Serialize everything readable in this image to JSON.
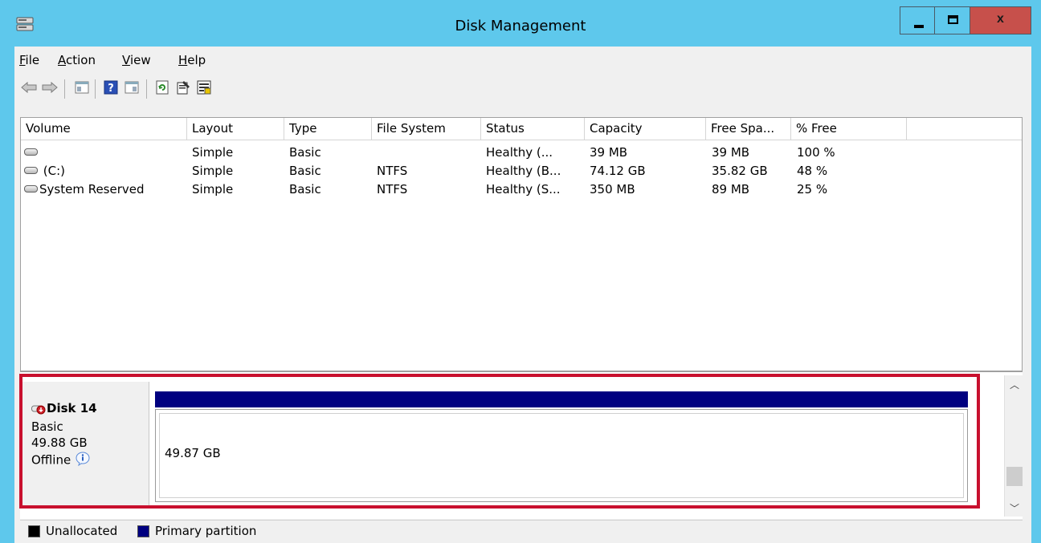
{
  "window": {
    "title": "Disk Management"
  },
  "menubar": {
    "items": [
      {
        "label": "File",
        "underline": "F"
      },
      {
        "label": "Action",
        "underline": "A"
      },
      {
        "label": "View",
        "underline": "V"
      },
      {
        "label": "Help",
        "underline": "H"
      }
    ]
  },
  "toolbar": {
    "buttons": [
      "back-icon",
      "forward-icon",
      "show-hide-console-tree-icon",
      "help-icon",
      "show-action-pane-icon",
      "refresh-icon",
      "properties-icon",
      "export-list-icon"
    ]
  },
  "volume_list": {
    "columns": [
      "Volume",
      "Layout",
      "Type",
      "File System",
      "Status",
      "Capacity",
      "Free Spa...",
      "% Free"
    ],
    "rows": [
      {
        "volume": "",
        "layout": "Simple",
        "type": "Basic",
        "file_system": "",
        "status": "Healthy (...",
        "capacity": "39 MB",
        "free_space": "39 MB",
        "percent_free": "100 %"
      },
      {
        "volume": "(C:)",
        "layout": "Simple",
        "type": "Basic",
        "file_system": "NTFS",
        "status": "Healthy (B...",
        "capacity": "74.12 GB",
        "free_space": "35.82 GB",
        "percent_free": "48 %"
      },
      {
        "volume": "System Reserved",
        "layout": "Simple",
        "type": "Basic",
        "file_system": "NTFS",
        "status": "Healthy (S...",
        "capacity": "350 MB",
        "free_space": "89 MB",
        "percent_free": "25 %"
      }
    ]
  },
  "disk": {
    "name": "Disk 14",
    "type": "Basic",
    "size": "49.88 GB",
    "status": "Offline",
    "partition_size": "49.87 GB"
  },
  "legend": {
    "items": [
      {
        "label": "Unallocated",
        "color": "#000000"
      },
      {
        "label": "Primary partition",
        "color": "#000080"
      }
    ]
  },
  "colors": {
    "titlebar": "#5ec8ec",
    "close_button": "#c7504b",
    "highlight": "#c8102e",
    "primary_partition": "#000080"
  }
}
